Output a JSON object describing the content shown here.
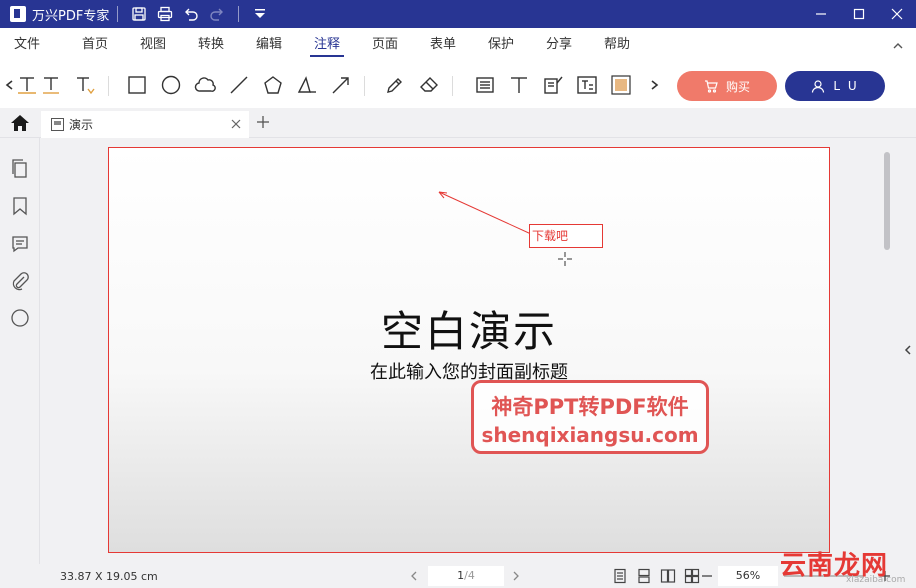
{
  "app": {
    "title": "万兴PDF专家"
  },
  "menu": {
    "items": [
      "文件",
      "首页",
      "视图",
      "转换",
      "编辑",
      "注释",
      "页面",
      "表单",
      "保护",
      "分享",
      "帮助"
    ],
    "active_index": 5
  },
  "toolbar": {
    "buy_label": "购买",
    "login_label": "L U"
  },
  "tab": {
    "label": "演示"
  },
  "slide": {
    "title": "空白演示",
    "subtitle": "在此输入您的封面副标题",
    "callout": "下载吧",
    "watermark_line1": "神奇PPT转PDF软件",
    "watermark_line2": "shenqixiangsu.com"
  },
  "status": {
    "page_size": "33.87 X 19.05 cm",
    "current_page": "1",
    "total_pages": "/4",
    "zoom": "56%"
  },
  "site_mark": {
    "text": "云南龙网",
    "sub": "xiazaiba.com"
  },
  "colors": {
    "brand": "#283593",
    "buy": "#f07a6a",
    "annotation": "#e53935"
  }
}
